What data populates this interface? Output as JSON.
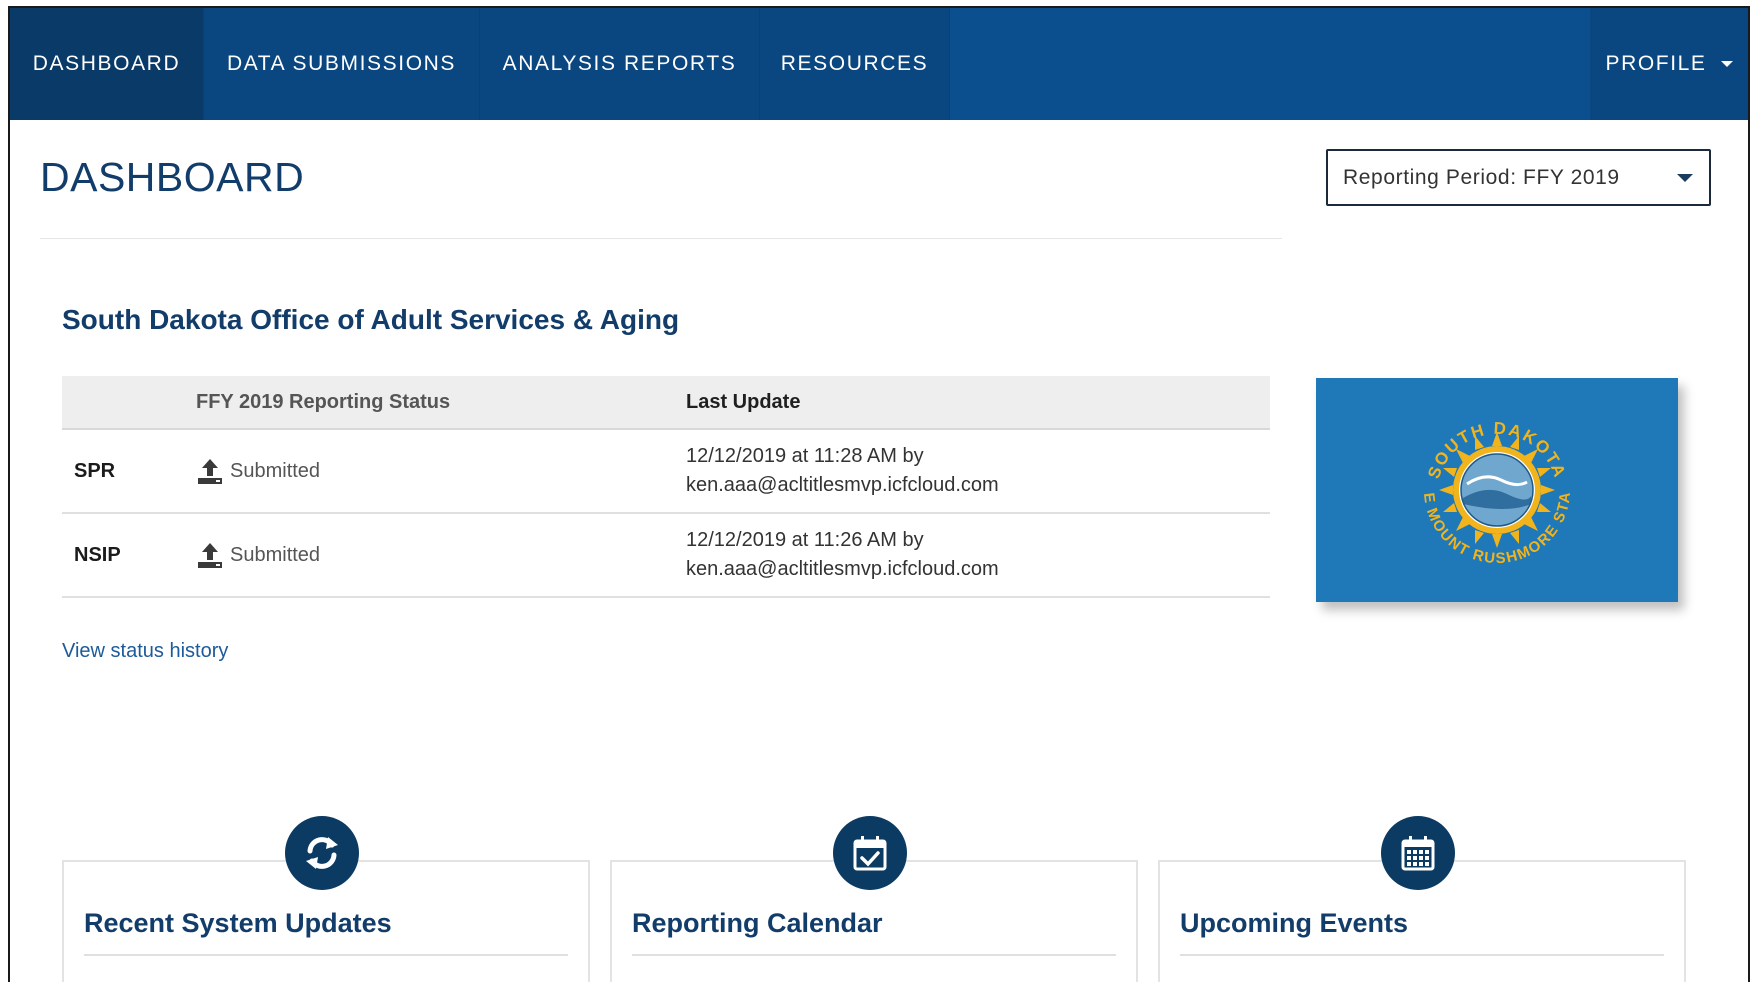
{
  "nav": {
    "items": [
      {
        "label": "DASHBOARD"
      },
      {
        "label": "DATA SUBMISSIONS"
      },
      {
        "label": "ANALYSIS REPORTS"
      },
      {
        "label": "RESOURCES"
      }
    ],
    "profile_label": "PROFILE"
  },
  "page": {
    "title": "DASHBOARD",
    "reporting_period": "Reporting Period: FFY 2019"
  },
  "org": {
    "name": "South Dakota Office of Adult Services & Aging"
  },
  "status_table": {
    "headers": [
      "",
      "FFY 2019 Reporting Status",
      "Last Update"
    ],
    "rows": [
      {
        "name": "SPR",
        "status": "Submitted",
        "update_line1": "12/12/2019 at 11:28 AM by",
        "update_line2": "ken.aaa@acltitlesmvp.icfcloud.com"
      },
      {
        "name": "NSIP",
        "status": "Submitted",
        "update_line1": "12/12/2019 at 11:26 AM by",
        "update_line2": "ken.aaa@acltitlesmvp.icfcloud.com"
      }
    ],
    "history_link": "View status history"
  },
  "flag": {
    "seal_top": "SOUTH DAKOTA",
    "seal_bottom": "THE MOUNT RUSHMORE STATE"
  },
  "cards": [
    {
      "title": "Recent System Updates",
      "icon": "refresh-icon"
    },
    {
      "title": "Reporting Calendar",
      "icon": "calendar-check-icon"
    },
    {
      "title": "Upcoming Events",
      "icon": "calendar-grid-icon"
    }
  ],
  "colors": {
    "nav_bg": "#0b4f8e",
    "nav_active": "#0a3a67",
    "heading": "#123c69",
    "link": "#1d5a9a",
    "flag_blue": "#1f78b8",
    "seal_gold": "#f1b41c"
  }
}
